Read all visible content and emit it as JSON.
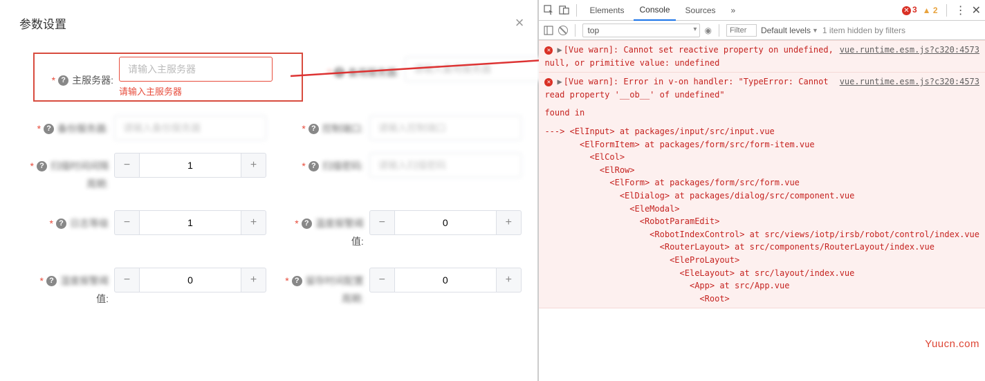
{
  "dialog": {
    "title": "参数设置",
    "close": "×"
  },
  "form": {
    "main_server": {
      "label": "主服务器:",
      "placeholder": "请输入主服务器",
      "error": "请输入主服务器"
    },
    "backup_server": {
      "label": "备用服务器:",
      "placeholder": "请输入备用服务器"
    },
    "field3": {
      "label": "备份服务器:",
      "placeholder": "请输入备份服务器"
    },
    "field4": {
      "label": "控制端口:",
      "placeholder": "请输入控制端口"
    },
    "interval": {
      "label": "扫描时间间隔",
      "sub": "周期:",
      "value": "1"
    },
    "field6": {
      "label": "扫描密码:",
      "placeholder": "请输入扫描密码"
    },
    "level": {
      "label": "日志等级",
      "value": "1"
    },
    "threshold1": {
      "label": "温度报警阈",
      "sub": "值:",
      "value": "0"
    },
    "threshold2": {
      "label": "湿度报警阈",
      "sub": "值:",
      "value": "0"
    },
    "threshold3": {
      "label": "留存时间配置",
      "sub": "周期:",
      "value": "0"
    }
  },
  "devtools": {
    "tabs": {
      "elements": "Elements",
      "console": "Console",
      "sources": "Sources"
    },
    "more_tabs": "»",
    "err_count": "3",
    "warn_count": "2",
    "filter": {
      "context": "top",
      "placeholder": "Filter",
      "levels": "Default levels",
      "hidden": "1 item hidden by filters"
    },
    "logs": [
      {
        "src": "vue.runtime.esm.js?c320:4573",
        "text": "[Vue warn]: Cannot set reactive property on undefined, null, or primitive value: undefined"
      },
      {
        "src": "vue.runtime.esm.js?c320:4573",
        "text": "[Vue warn]: Error in v-on handler: \"TypeError: Cannot read property '__ob__' of undefined\"",
        "found_in": "found in",
        "trace": "---> <ElInput> at packages/input/src/input.vue\n       <ElFormItem> at packages/form/src/form-item.vue\n         <ElCol>\n           <ElRow>\n             <ElForm> at packages/form/src/form.vue\n               <ElDialog> at packages/dialog/src/component.vue\n                 <EleModal>\n                   <RobotParamEdit>\n                     <RobotIndexControl> at src/views/iotp/irsb/robot/control/index.vue\n                       <RouterLayout> at src/components/RouterLayout/index.vue\n                         <EleProLayout>\n                           <EleLayout> at src/layout/index.vue\n                             <App> at src/App.vue\n                               <Root>"
      }
    ]
  },
  "watermark": "Yuucn.com"
}
